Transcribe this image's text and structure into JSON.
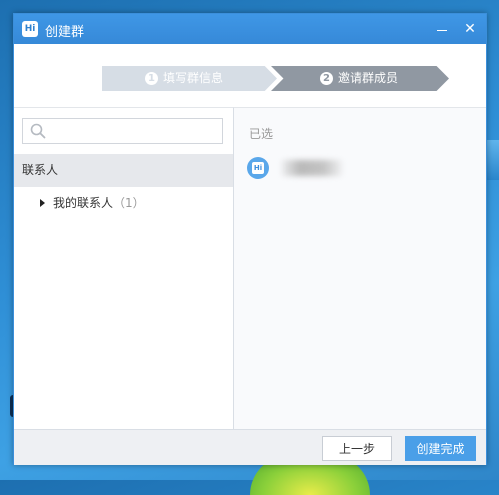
{
  "window": {
    "title": "创建群",
    "logo_text": "Hi"
  },
  "titlebar": {
    "minimize_glyph": "",
    "close_glyph": "✕"
  },
  "steps": [
    {
      "number": "1",
      "label": "填写群信息",
      "state": "done"
    },
    {
      "number": "2",
      "label": "邀请群成员",
      "state": "active"
    }
  ],
  "left": {
    "search_placeholder": "",
    "section_label": "联系人",
    "groups": [
      {
        "label": "我的联系人",
        "count": "（1）"
      }
    ]
  },
  "right": {
    "selected_label": "已选",
    "members": [
      {
        "name": "",
        "avatar_text": "Hi"
      }
    ]
  },
  "footer": {
    "prev_label": "上一步",
    "finish_label": "创建完成"
  },
  "colors": {
    "accent": "#3f97e6",
    "primary_button": "#4a9fe8",
    "step_active": "#9098a2",
    "step_done": "#d6dde5"
  }
}
